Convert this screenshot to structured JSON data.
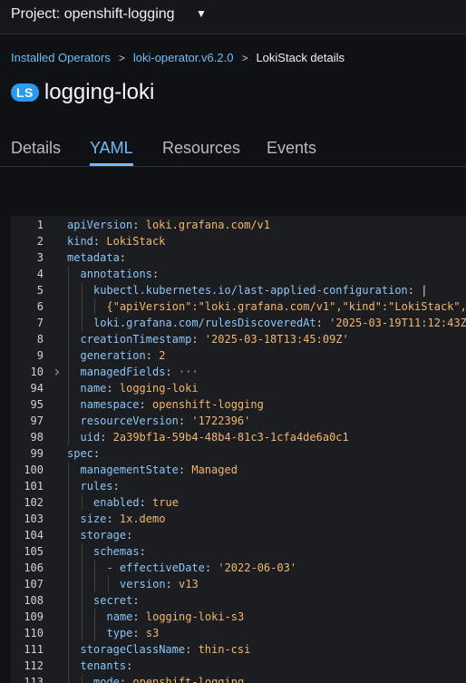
{
  "header": {
    "project": "Project: openshift-logging"
  },
  "breadcrumb": {
    "item1": "Installed Operators",
    "item2": "loki-operator.v6.2.0",
    "current": "LokiStack details"
  },
  "page": {
    "badge": "LS",
    "title": "logging-loki"
  },
  "tabs": [
    "Details",
    "YAML",
    "Resources",
    "Events"
  ],
  "yaml": {
    "lines": [
      {
        "n": "1",
        "indent": 0,
        "key": "apiVersion",
        "val": "loki.grafana.com/v1"
      },
      {
        "n": "2",
        "indent": 0,
        "key": "kind",
        "val": "LokiStack"
      },
      {
        "n": "3",
        "indent": 0,
        "key": "metadata",
        "val": ""
      },
      {
        "n": "4",
        "indent": 1,
        "key": "annotations",
        "val": ""
      },
      {
        "n": "5",
        "indent": 2,
        "key": "kubectl.kubernetes.io/last-applied-configuration",
        "val": "|"
      },
      {
        "n": "6",
        "indent": 3,
        "key": "",
        "val": "{\"apiVersion\":\"loki.grafana.com/v1\",\"kind\":\"LokiStack\","
      },
      {
        "n": "7",
        "indent": 2,
        "key": "loki.grafana.com/rulesDiscoveredAt",
        "val": "'2025-03-19T11:12:43Z"
      },
      {
        "n": "8",
        "indent": 1,
        "key": "creationTimestamp",
        "val": "'2025-03-18T13:45:09Z'"
      },
      {
        "n": "9",
        "indent": 1,
        "key": "generation",
        "val": "2"
      },
      {
        "n": "10",
        "indent": 1,
        "key": "managedFields",
        "val": "···",
        "folded": true
      },
      {
        "n": "94",
        "indent": 1,
        "key": "name",
        "val": "logging-loki"
      },
      {
        "n": "95",
        "indent": 1,
        "key": "namespace",
        "val": "openshift-logging"
      },
      {
        "n": "97",
        "indent": 1,
        "key": "resourceVersion",
        "val": "'1722396'"
      },
      {
        "n": "98",
        "indent": 1,
        "key": "uid",
        "val": "2a39bf1a-59b4-48b4-81c3-1cfa4de6a0c1"
      },
      {
        "n": "99",
        "indent": 0,
        "key": "spec",
        "val": ""
      },
      {
        "n": "100",
        "indent": 1,
        "key": "managementState",
        "val": "Managed"
      },
      {
        "n": "101",
        "indent": 1,
        "key": "rules",
        "val": ""
      },
      {
        "n": "102",
        "indent": 2,
        "key": "enabled",
        "val": "true"
      },
      {
        "n": "103",
        "indent": 1,
        "key": "size",
        "val": "1x.demo"
      },
      {
        "n": "104",
        "indent": 1,
        "key": "storage",
        "val": ""
      },
      {
        "n": "105",
        "indent": 2,
        "key": "schemas",
        "val": ""
      },
      {
        "n": "106",
        "indent": 3,
        "key": "- effectiveDate",
        "val": "'2022-06-03'"
      },
      {
        "n": "107",
        "indent": 4,
        "key": "version",
        "val": "v13"
      },
      {
        "n": "108",
        "indent": 2,
        "key": "secret",
        "val": ""
      },
      {
        "n": "109",
        "indent": 3,
        "key": "name",
        "val": "logging-loki-s3"
      },
      {
        "n": "110",
        "indent": 3,
        "key": "type",
        "val": "s3"
      },
      {
        "n": "111",
        "indent": 1,
        "key": "storageClassName",
        "val": "thin-csi"
      },
      {
        "n": "112",
        "indent": 1,
        "key": "tenants",
        "val": ""
      },
      {
        "n": "113",
        "indent": 2,
        "key": "mode",
        "val": "openshift-logging"
      }
    ]
  }
}
